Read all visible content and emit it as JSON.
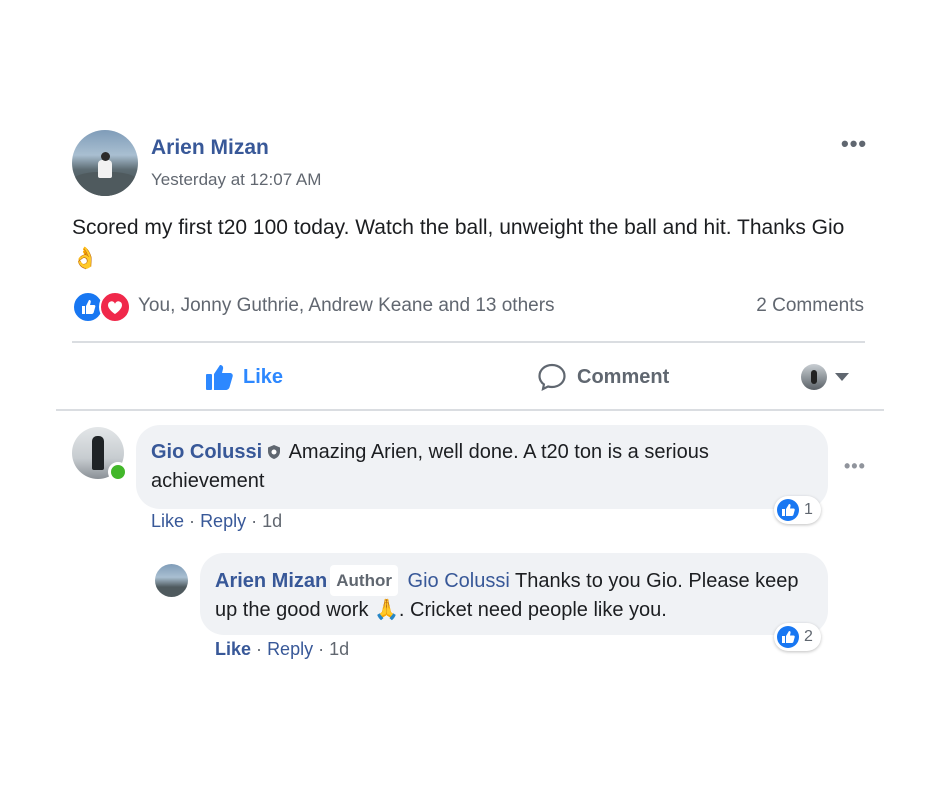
{
  "post": {
    "author": "Arien Mizan",
    "timestamp": "Yesterday at 12:07 AM",
    "text": "Scored my first t20 100 today. Watch the ball, unweight the ball and hit. Thanks Gio",
    "text_emoji": "👌",
    "more_label": "•••",
    "reactors": "You, Jonny Guthrie, Andrew Keane and 13 others",
    "comments_count": "2 Comments",
    "reactions": [
      "like-icon",
      "love-icon"
    ]
  },
  "actions": {
    "like_label": "Like",
    "comment_label": "Comment"
  },
  "comments": [
    {
      "author": "Gio Colussi",
      "text": "Amazing Arien, well done. A t20 ton is a serious achievement",
      "like_count": "1",
      "like_label": "Like",
      "reply_label": "Reply",
      "age": "1d",
      "separator": "·",
      "more_label": "•••",
      "online": true
    }
  ],
  "reply": {
    "author": "Arien Mizan",
    "author_tag": "Author",
    "mention": "Gio Colussi",
    "text_before": "Thanks to you Gio. Please keep up the good work",
    "emoji": "🙏",
    "text_after": ". Cricket need people like you.",
    "like_count": "2",
    "like_label": "Like",
    "reply_label": "Reply",
    "age": "1d",
    "separator": "·"
  },
  "colors": {
    "link_blue": "#385898",
    "like_blue": "#2d88ff",
    "bubble_gray": "#f0f2f5",
    "online_green": "#42b72a",
    "love_red": "#f0284a"
  }
}
